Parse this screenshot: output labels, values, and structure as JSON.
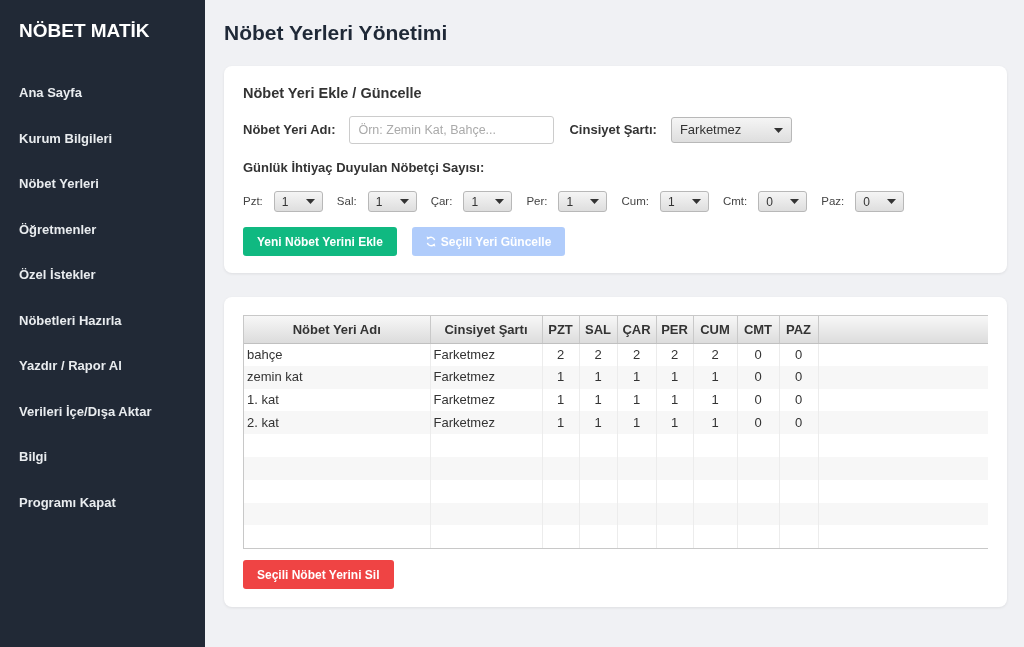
{
  "sidebar": {
    "title": "NÖBET MATİK",
    "items": [
      "Ana Sayfa",
      "Kurum Bilgileri",
      "Nöbet Yerleri",
      "Öğretmenler",
      "Özel İstekler",
      "Nöbetleri Hazırla",
      "Yazdır / Rapor Al",
      "Verileri İçe/Dışa Aktar",
      "Bilgi",
      "Programı Kapat"
    ]
  },
  "page_title": "Nöbet Yerleri Yönetimi",
  "form": {
    "title": "Nöbet Yeri Ekle / Güncelle",
    "name_field": {
      "label": "Nöbet Yeri Adı:",
      "placeholder": "Örn: Zemin Kat, Bahçe..."
    },
    "gender_field": {
      "label": "Cinsiyet Şartı:",
      "value": "Farketmez"
    },
    "daily_label": "Günlük İhtiyaç Duyulan Nöbetçi Sayısı:",
    "days": [
      {
        "label": "Pzt:",
        "value": "1"
      },
      {
        "label": "Sal:",
        "value": "1"
      },
      {
        "label": "Çar:",
        "value": "1"
      },
      {
        "label": "Per:",
        "value": "1"
      },
      {
        "label": "Cum:",
        "value": "1"
      },
      {
        "label": "Cmt:",
        "value": "0"
      },
      {
        "label": "Paz:",
        "value": "0"
      }
    ],
    "buttons": [
      {
        "label": "Yeni Nöbet Yerini Ekle",
        "kind": "add",
        "disabled": false
      },
      {
        "label": "Seçili Yeri Güncelle",
        "kind": "update",
        "disabled": true
      }
    ]
  },
  "table": {
    "columns": [
      "Nöbet Yeri Adı",
      "Cinsiyet Şartı",
      "PZT",
      "SAL",
      "ÇAR",
      "PER",
      "CUM",
      "CMT",
      "PAZ"
    ],
    "rows": [
      [
        "bahçe",
        "Farketmez",
        "2",
        "2",
        "2",
        "2",
        "2",
        "0",
        "0"
      ],
      [
        "zemin kat",
        "Farketmez",
        "1",
        "1",
        "1",
        "1",
        "1",
        "0",
        "0"
      ],
      [
        "1. kat",
        "Farketmez",
        "1",
        "1",
        "1",
        "1",
        "1",
        "0",
        "0"
      ],
      [
        "2. kat",
        "Farketmez",
        "1",
        "1",
        "1",
        "1",
        "1",
        "0",
        "0"
      ]
    ]
  },
  "delete_button": {
    "label": "Seçili Nöbet Yerini Sil",
    "kind": "delete",
    "disabled": false
  }
}
